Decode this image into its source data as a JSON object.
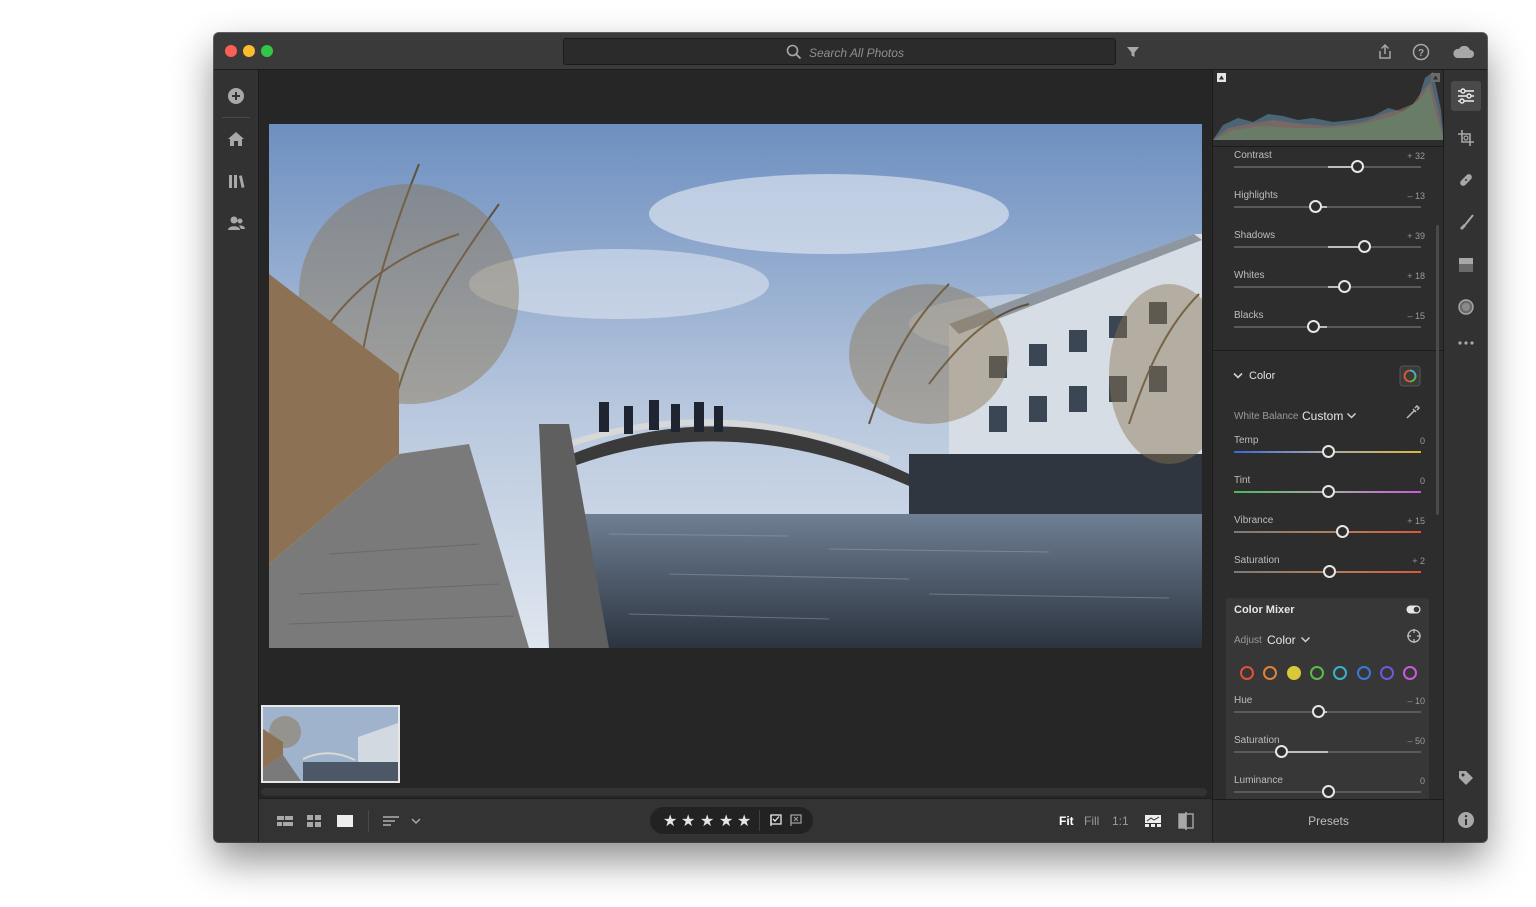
{
  "search": {
    "placeholder": "Search All Photos"
  },
  "edit_panel": {
    "light_sliders": [
      {
        "label": "Contrast",
        "value": "+ 32",
        "level": 32
      },
      {
        "label": "Highlights",
        "value": "– 13",
        "level": -13
      },
      {
        "label": "Shadows",
        "value": "+ 39",
        "level": 39
      },
      {
        "label": "Whites",
        "value": "+ 18",
        "level": 18
      },
      {
        "label": "Blacks",
        "value": "– 15",
        "level": -15
      }
    ],
    "color_section": {
      "title": "Color",
      "white_balance_label": "White Balance",
      "white_balance_value": "Custom",
      "sliders": [
        {
          "label": "Temp",
          "value": "0",
          "level": 0
        },
        {
          "label": "Tint",
          "value": "0",
          "level": 0
        },
        {
          "label": "Vibrance",
          "value": "+ 15",
          "level": 15
        },
        {
          "label": "Saturation",
          "value": "+ 2",
          "level": 2
        }
      ]
    },
    "color_mixer": {
      "title": "Color Mixer",
      "adjust_label": "Adjust",
      "adjust_value": "Color",
      "swatches": [
        "#e0503a",
        "#e0823a",
        "#d8c93a",
        "#5fb84a",
        "#3ab3c9",
        "#3a78d8",
        "#6a5ad8",
        "#c95ad8"
      ],
      "selected_swatch_index": 2,
      "sliders": [
        {
          "label": "Hue",
          "value": "– 10",
          "level": -10
        },
        {
          "label": "Saturation",
          "value": "– 50",
          "level": -50
        },
        {
          "label": "Luminance",
          "value": "0",
          "level": 0
        }
      ]
    },
    "presets_label": "Presets"
  },
  "bottom_bar": {
    "rating_stars": 5,
    "zoom_options": [
      "Fit",
      "Fill",
      "1:1"
    ],
    "active_zoom": "Fit"
  },
  "icons": {
    "left": [
      "add-icon",
      "home-icon",
      "library-icon",
      "people-icon"
    ],
    "right": [
      "edit-sliders-icon",
      "crop-icon",
      "healing-icon",
      "brush-icon",
      "linear-gradient-icon",
      "radial-gradient-icon",
      "more-icon",
      "keyword-icon",
      "info-icon"
    ]
  }
}
